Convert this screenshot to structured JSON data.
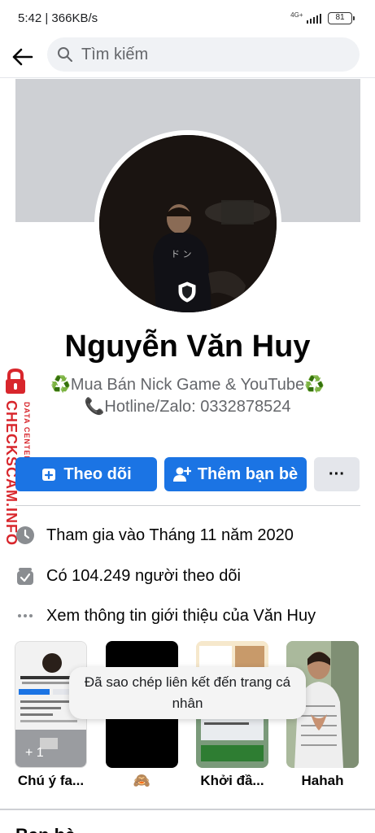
{
  "status_bar": {
    "time_speed": "5:42 | 366KB/s",
    "network_type": "4G+",
    "battery": "81"
  },
  "search": {
    "placeholder": "Tìm kiếm"
  },
  "profile": {
    "name": "Nguyễn Văn Huy",
    "bio_line_1_prefix": "♻️",
    "bio_line_1_text": "Mua Bán Nick Game & YouTube",
    "bio_line_1_suffix": "♻️",
    "bio_line_2_icon": "📞",
    "bio_line_2_text": "Hotline/Zalo: 0332878524"
  },
  "actions": {
    "follow_label": "Theo dõi",
    "add_friend_label": "Thêm bạn bè",
    "more_label": "···"
  },
  "info": {
    "joined": "Tham gia vào Tháng 11 năm 2020",
    "followers": "Có 104.249 người theo dõi",
    "about": "Xem thông tin giới thiệu của Văn Huy"
  },
  "highlights": [
    {
      "label": "Chú ý fa...",
      "count": "+ 1"
    },
    {
      "label": "🙈"
    },
    {
      "label": "Khởi đầ..."
    },
    {
      "label": "Hahah"
    }
  ],
  "toast": {
    "message": "Đã sao chép liên kết đến trang cá nhân"
  },
  "watermark": {
    "brand": "CHECKSCAM.INFO",
    "sub": "DATA CENTER"
  },
  "section_peek": "Bạn bè",
  "colors": {
    "primary_blue": "#1b74e4",
    "secondary_gray": "#e4e6eb",
    "text_secondary": "#65676b",
    "watermark_red": "#d8262c"
  }
}
